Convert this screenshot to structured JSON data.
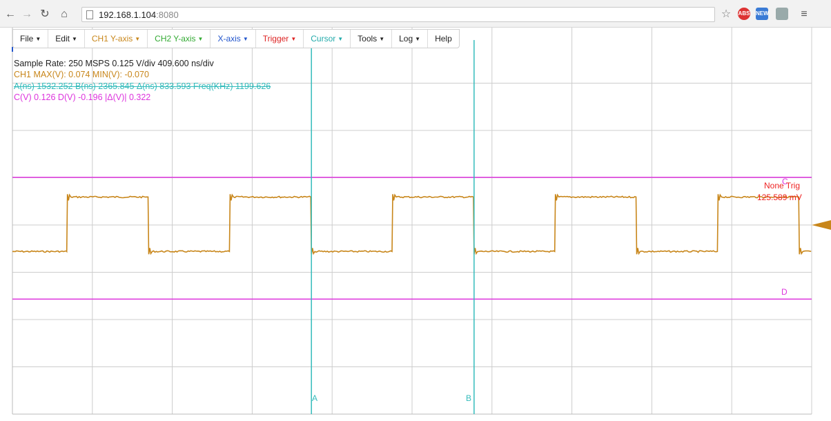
{
  "browser": {
    "url_host": "192.168.1.104",
    "url_port": ":8080",
    "ext_abs": "ABS",
    "ext_new": "NEW"
  },
  "menu": [
    {
      "label": "File",
      "color": "#222222"
    },
    {
      "label": "Edit",
      "color": "#222222"
    },
    {
      "label": "CH1 Y-axis",
      "color": "#c8861a"
    },
    {
      "label": "CH2 Y-axis",
      "color": "#33aa33"
    },
    {
      "label": "X-axis",
      "color": "#2255cc"
    },
    {
      "label": "Trigger",
      "color": "#dd2222"
    },
    {
      "label": "Cursor",
      "color": "#22aaaa"
    },
    {
      "label": "Tools",
      "color": "#222222"
    },
    {
      "label": "Log",
      "color": "#222222"
    },
    {
      "label": "Help",
      "color": "#222222"
    }
  ],
  "info": {
    "sample": "Sample Rate: 250 MSPS  0.125 V/div  409.600 ns/div",
    "ch1": "CH1 MAX(V): 0.074  MIN(V): -0.070",
    "cursor_time": "A(ns) 1532.252  B(ns) 2365.845  Δ(ns) 833.593  Freq(KHz) 1199.626",
    "cursor_volt": "C(V) 0.126  D(V) -0.196  |Δ(V)| 0.322"
  },
  "cursors": {
    "a_label": "A",
    "b_label": "B",
    "c_label": "C",
    "d_label": "D"
  },
  "trigger": {
    "mode": "None Trig",
    "level": "125.589 mV"
  },
  "colors": {
    "ch1": "#c8861a",
    "cursor_ab": "#33bbbb",
    "cursor_cd": "#dd33dd",
    "trigger": "#ee2222",
    "grid": "#cccccc"
  },
  "scope": {
    "ch1_high_v": 0.074,
    "ch1_low_v": -0.07,
    "v_per_div": 0.125,
    "ns_per_div": 409.6,
    "period_ns": 833.593,
    "cursor_a_ns": 1532.252,
    "cursor_b_ns": 2365.845,
    "cursor_c_v": 0.126,
    "cursor_d_v": -0.196
  }
}
